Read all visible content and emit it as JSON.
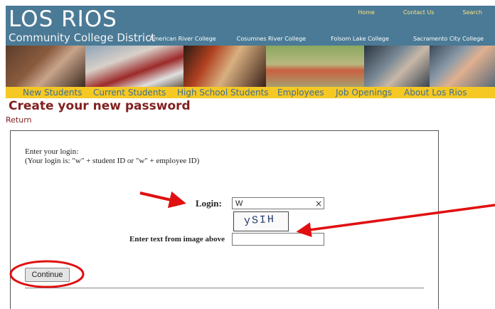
{
  "header": {
    "logo_main": "LOS RIOS",
    "logo_sub": "Community College District",
    "top_links": [
      "Home",
      "Contact Us",
      "Search"
    ],
    "colleges": [
      "American River College",
      "Cosumnes River College",
      "Folsom Lake College",
      "Sacramento City College"
    ]
  },
  "nav": {
    "items": [
      "New Students",
      "Current Students",
      "High School Students",
      "Employees",
      "Job Openings",
      "About Los Rios"
    ]
  },
  "page": {
    "title": "Create your new password",
    "return_label": "Return"
  },
  "form": {
    "instruction_line1": "Enter your login:",
    "instruction_line2": "(Your login is: \"w\" + student ID or \"w\" + employee ID)",
    "login_label": "Login:",
    "login_value": "W",
    "clear_glyph": "×",
    "captcha_text": "ySIH",
    "captcha_label": "Enter text from image above",
    "captcha_value": "",
    "continue_label": "Continue"
  },
  "colors": {
    "header_bg": "#4a7a96",
    "nav_bg": "#f5c824",
    "nav_text": "#3e6e95",
    "title_color": "#822020",
    "annotation_red": "#e01010"
  }
}
